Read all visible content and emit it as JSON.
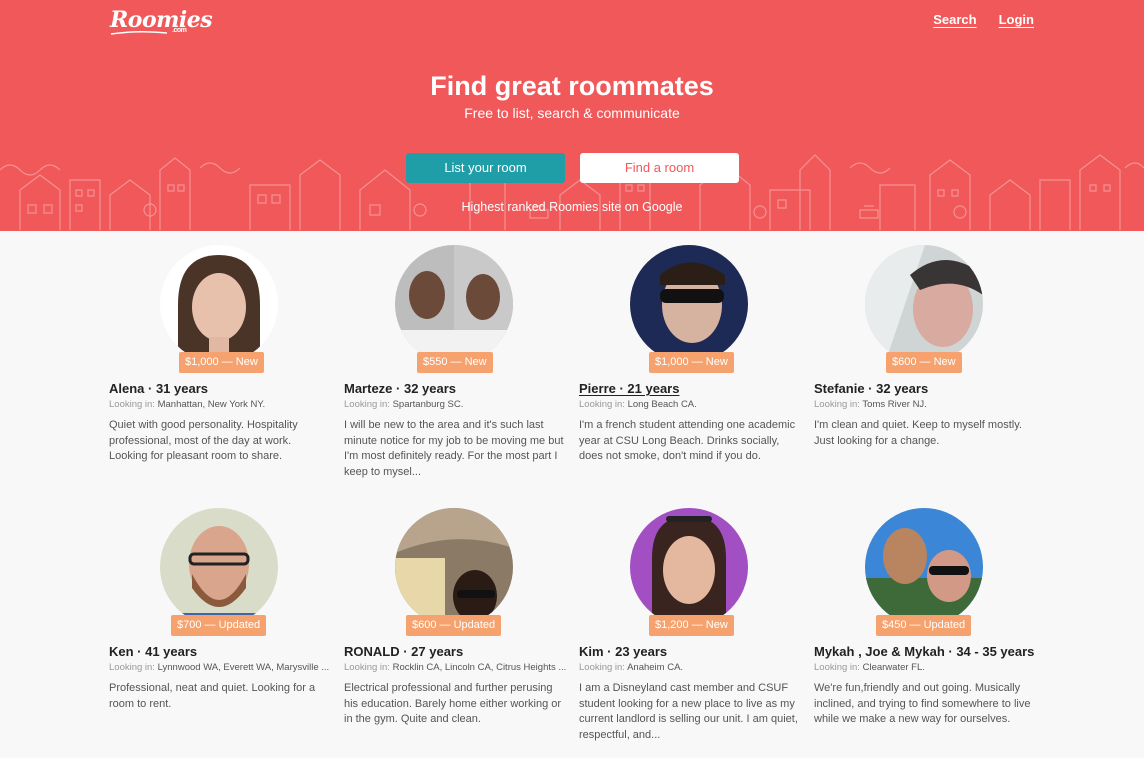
{
  "brand": {
    "logo": "Roomies",
    "logo_suffix": ".com"
  },
  "nav": {
    "search": "Search",
    "login": "Login"
  },
  "hero": {
    "title": "Find great roommates",
    "subtitle": "Free to list, search & communicate",
    "list_room": "List your room",
    "find_room": "Find a room",
    "note": "Highest ranked Roomies site on Google"
  },
  "looking_prefix": "Looking in:",
  "listings": [
    {
      "price": "$1,000 — New",
      "name": "Alena · 31 years",
      "location": "Manhattan, New York NY.",
      "description": "Quiet with good personality. Hospitality professional, most of the day at work. Looking for pleasant room to share."
    },
    {
      "price": "$550 — New",
      "name": "Marteze · 32 years",
      "location": "Spartanburg SC.",
      "description": "I will be new to the area and it's such last minute notice for my job to be moving me but I'm most definitely ready. For the most part I keep to mysel..."
    },
    {
      "price": "$1,000 — New",
      "name": "Pierre · 21 years",
      "location": "Long Beach CA.",
      "description": "I'm a french student attending one academic year at CSU Long Beach. Drinks socially, does not smoke, don't mind if you do."
    },
    {
      "price": "$600 — New",
      "name": "Stefanie · 32 years",
      "location": "Toms River NJ.",
      "description": "I'm clean and quiet. Keep to myself mostly. Just looking for a change."
    },
    {
      "price": "$700 — Updated",
      "name": "Ken · 41 years",
      "location": "Lynnwood WA,  Everett WA,  Marysville ...",
      "description": "Professional, neat and quiet. Looking for a room to rent."
    },
    {
      "price": "$600 — Updated",
      "name": "RONALD · 27 years",
      "location": "Rocklin CA,  Lincoln CA,  Citrus Heights ...",
      "description": "Electrical professional and further perusing his education. Barely home either working or in the gym. Quite and clean."
    },
    {
      "price": "$1,200 — New",
      "name": "Kim · 23 years",
      "location": "Anaheim CA.",
      "description": "I am a Disneyland cast member and CSUF student looking for a new place to live as my current landlord is selling our unit. I am quiet, respectful, and..."
    },
    {
      "price": "$450 — Updated",
      "name": "Mykah , Joe & Mykah · 34 - 35 years",
      "location": "Clearwater FL.",
      "description": "We're fun,friendly and out going. Musically inclined, and trying to find somewhere to live while we make a new way for ourselves."
    }
  ],
  "colors": {
    "brand_red": "#f0585a",
    "teal": "#1f9ea8",
    "badge_orange": "#f6a26e"
  }
}
